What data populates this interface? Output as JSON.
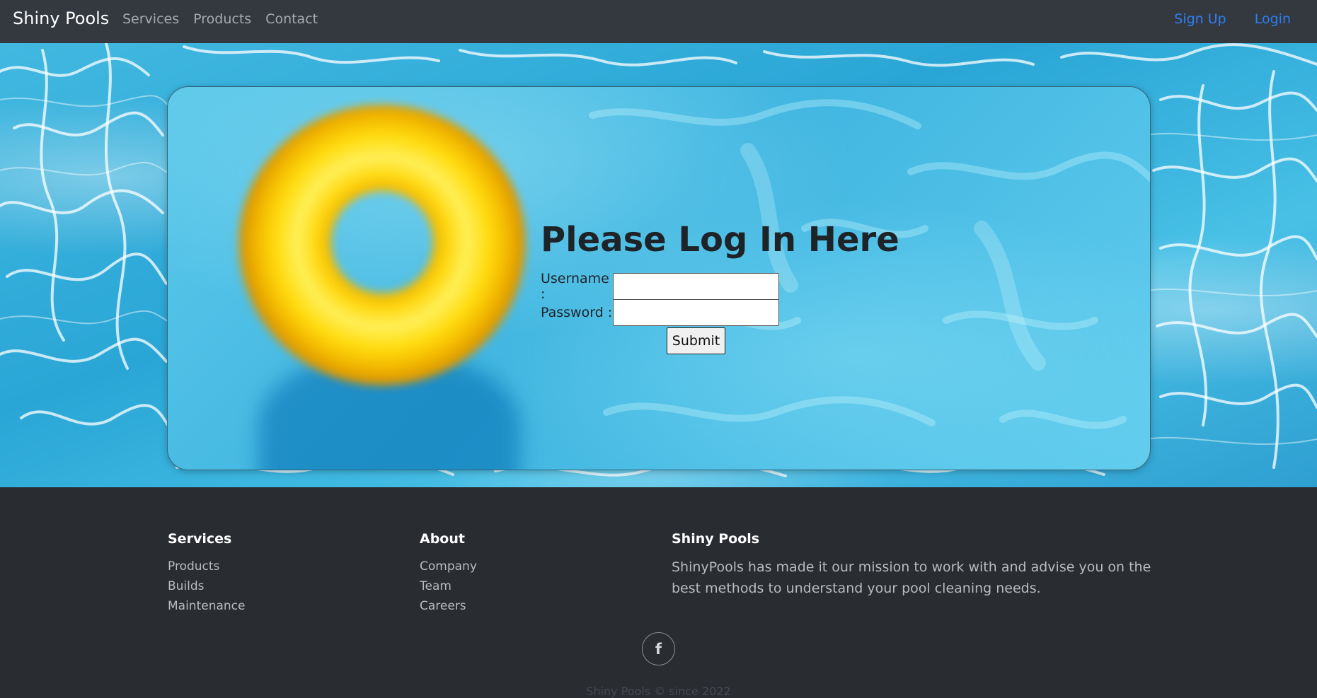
{
  "navbar": {
    "brand": "Shiny Pools",
    "links": [
      "Services",
      "Products",
      "Contact"
    ],
    "right_links": [
      "Sign Up",
      "Login"
    ]
  },
  "login": {
    "title": "Please Log In Here",
    "username_label": "Username :",
    "password_label": "Password :",
    "username_value": "",
    "password_value": "",
    "submit_label": "Submit"
  },
  "footer": {
    "services": {
      "heading": "Services",
      "links": [
        "Products",
        "Builds",
        "Maintenance"
      ]
    },
    "about": {
      "heading": "About",
      "links": [
        "Company",
        "Team",
        "Careers"
      ]
    },
    "company": {
      "heading": "Shiny Pools",
      "text": "ShinyPools has made it our mission to work with and advise you on the best methods to understand your pool cleaning needs."
    },
    "social_icon": "facebook-icon",
    "social_glyph": "f",
    "copyright": "Shiny Pools © since 2022"
  },
  "colors": {
    "navbar_bg": "#343940",
    "footer_bg": "#292c31",
    "link_accent": "#2f7ff1",
    "water": "#3fb5e0",
    "float": "#ffd914"
  }
}
